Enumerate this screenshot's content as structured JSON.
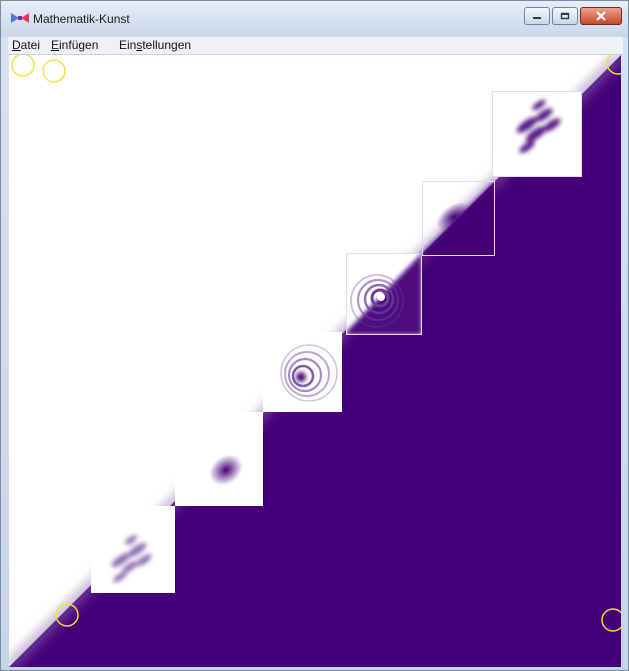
{
  "window": {
    "title": "Mathematik-Kunst",
    "app_icon": "bowtie-app-icon",
    "buttons": {
      "minimize": "minimize-icon",
      "maximize": "maximize-icon",
      "close": "close-icon"
    }
  },
  "menu": [
    {
      "label": "Datei",
      "mnemonic": "D",
      "rest": "atei"
    },
    {
      "label": "Einfügen",
      "mnemonic": "E",
      "rest": "infügen"
    },
    {
      "label": "Einstellungen",
      "prefix": "Ein",
      "mnemonic": "s",
      "rest": "tellungen"
    }
  ],
  "colors": {
    "purple": "#440078",
    "white": "#ffffff",
    "circle_stroke": "#f2e23a",
    "tile_border": "#e2daf0",
    "titlebar_close": "#c9452b"
  }
}
